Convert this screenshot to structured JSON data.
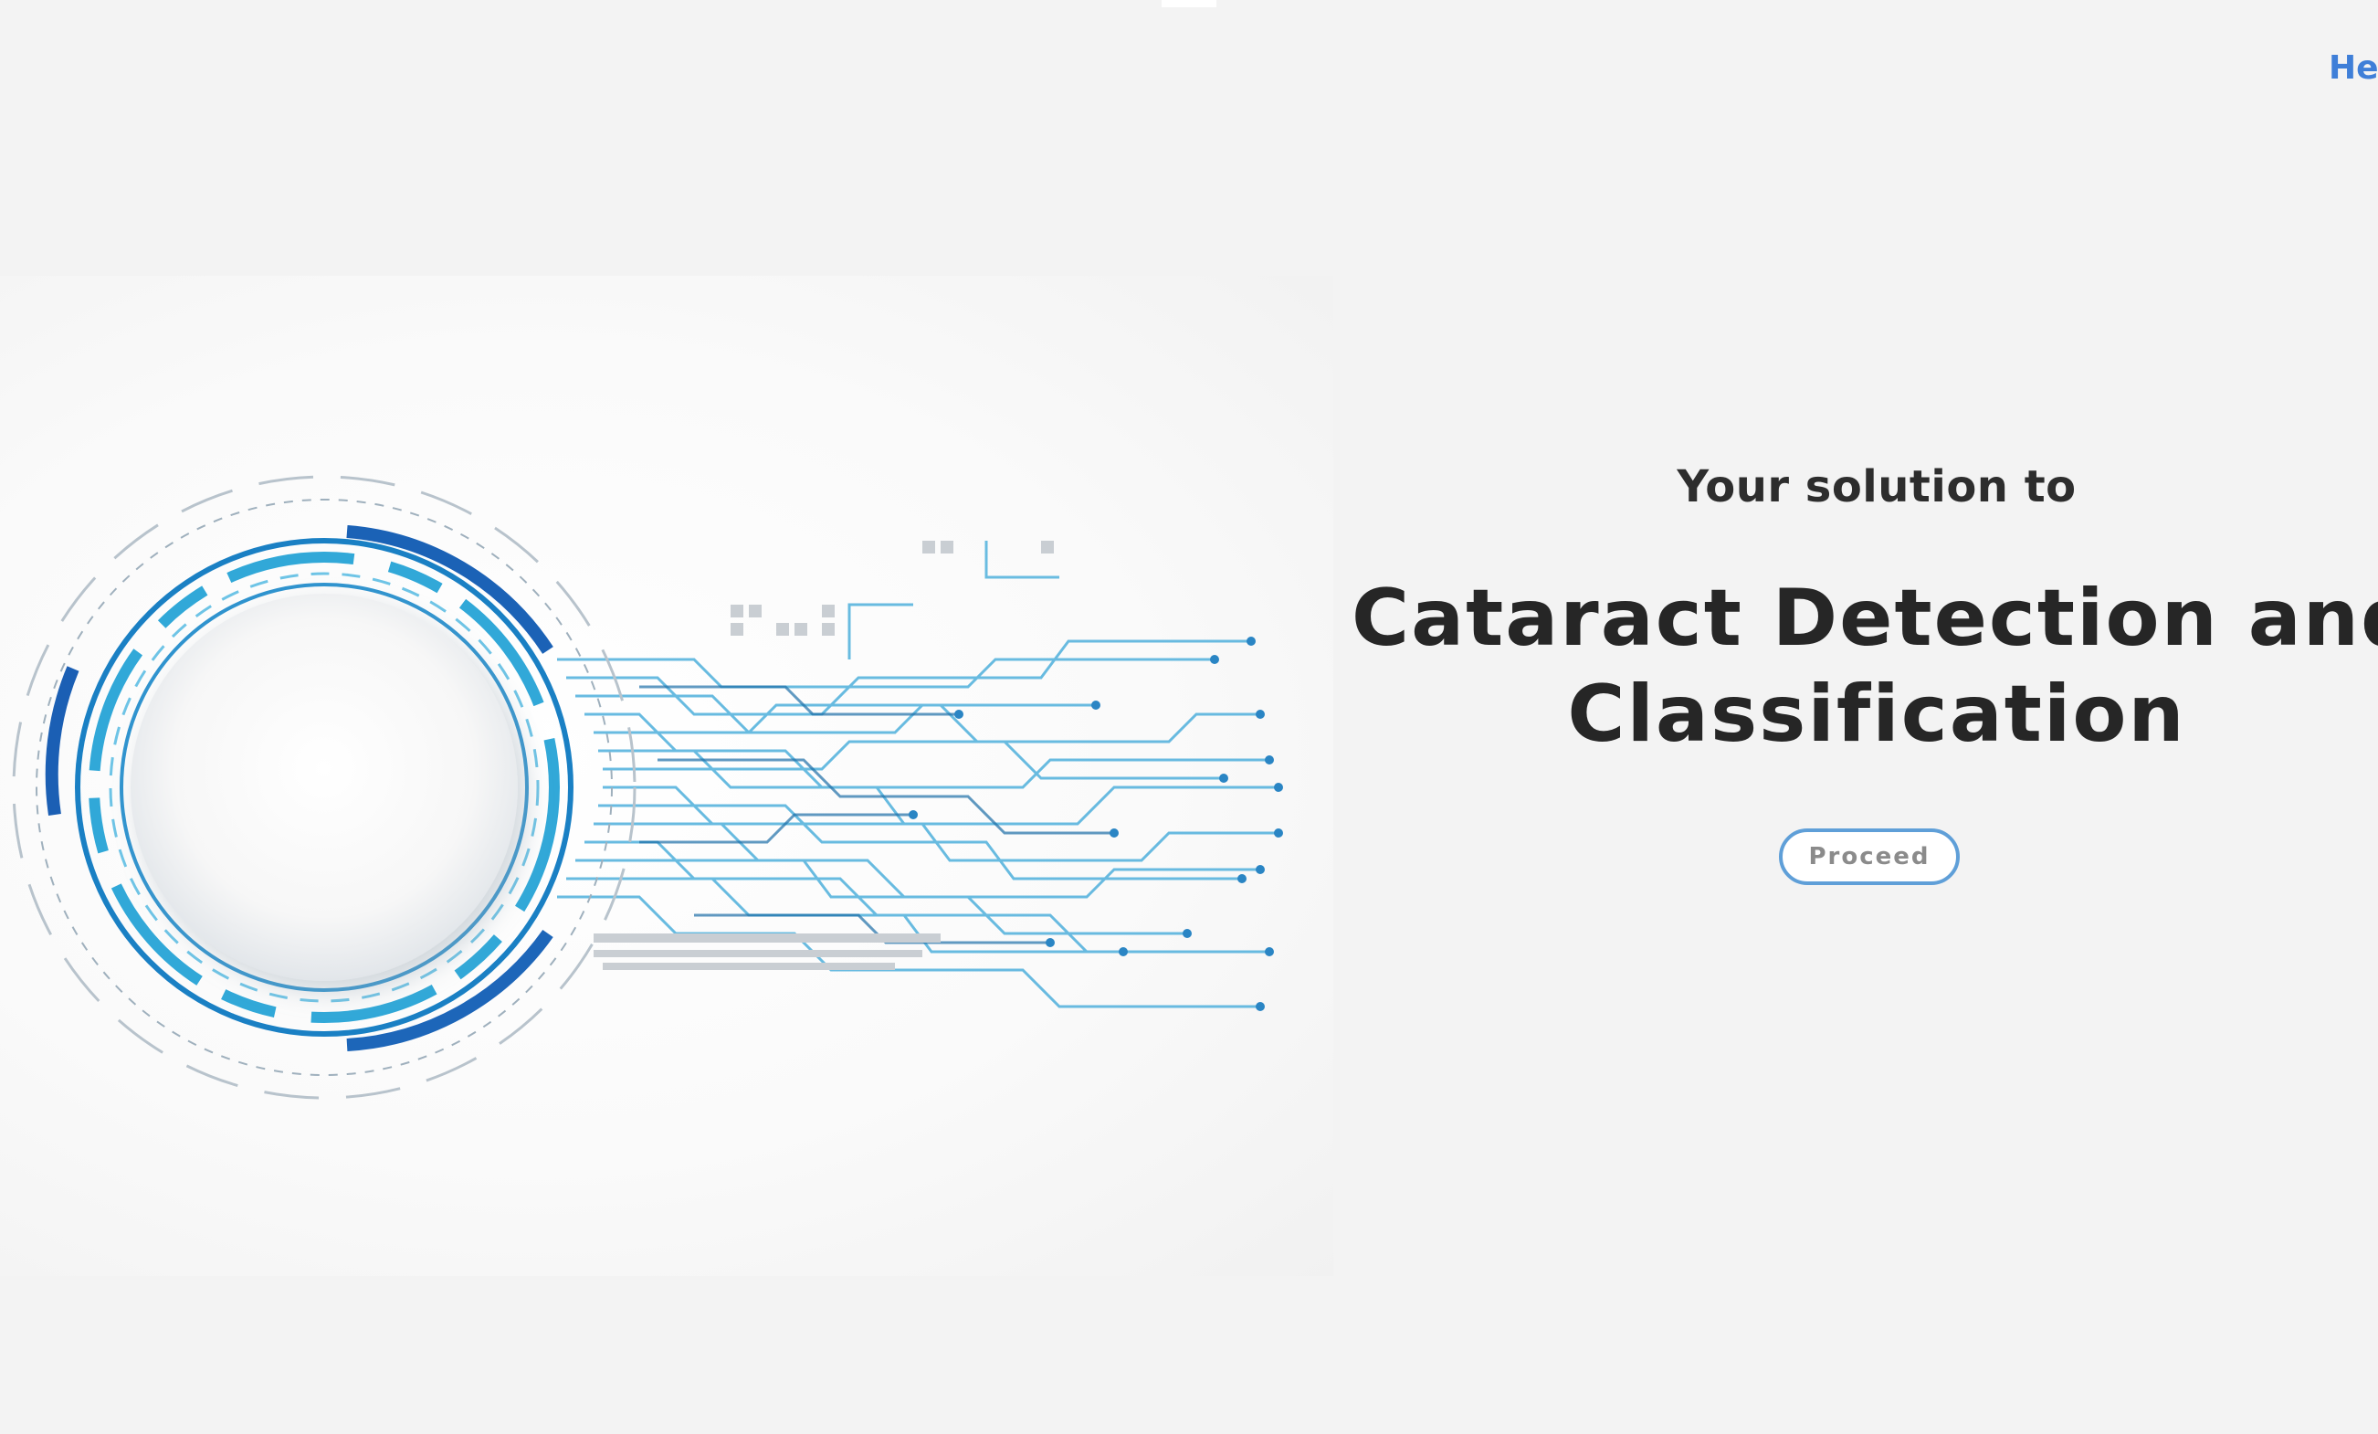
{
  "header": {
    "nav_link_label": "He"
  },
  "hero": {
    "image_name": "circuit-eye-illustration",
    "accent_colors": [
      "#1f8fd0",
      "#0d5fb0",
      "#5fc8e8"
    ]
  },
  "main": {
    "tagline": "Your solution to",
    "headline_line1": "Cataract Detection and",
    "headline_line2": "Classification",
    "proceed_label": "Proceed"
  },
  "colors": {
    "background": "#f3f3f3",
    "heading": "#262626",
    "link": "#3f7fd8",
    "button_border": "#5f9fd8",
    "button_text": "#8b8b8b"
  }
}
